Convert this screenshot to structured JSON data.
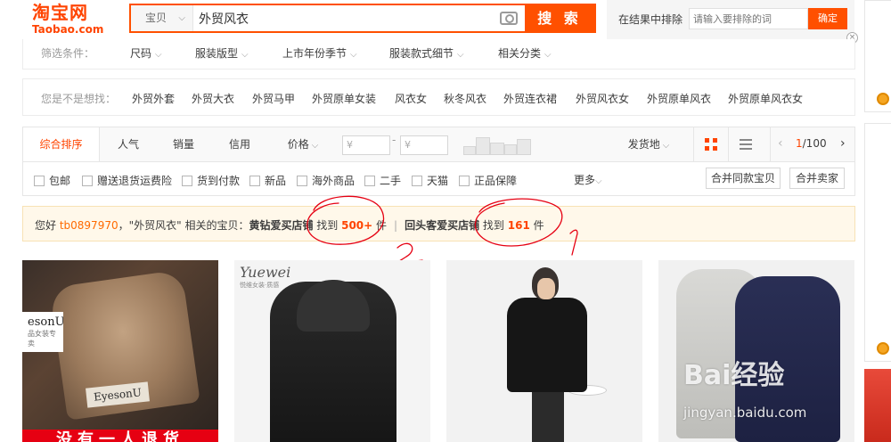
{
  "header": {
    "logo_cn": "淘宝网",
    "logo_en": "Taobao.com",
    "search_category": "宝贝",
    "search_query": "外贸风衣",
    "search_button": "搜 索",
    "exclude_label": "在结果中排除",
    "exclude_placeholder": "请输入要排除的词",
    "exclude_button": "确定"
  },
  "filters": {
    "title": "筛选条件：",
    "items": [
      "尺码",
      "服装版型",
      "上市年份季节",
      "服装款式细节",
      "相关分类"
    ]
  },
  "suggestions": {
    "title": "您是不是想找：",
    "items": [
      "外贸外套",
      "外贸大衣",
      "外贸马甲",
      "外贸原单女装",
      "风衣女",
      "秋冬风衣",
      "外贸连衣裙",
      "外贸风衣女",
      "外贸原单风衣",
      "外贸原单风衣女"
    ]
  },
  "sortbar": {
    "tabs": [
      "综合排序",
      "人气",
      "销量",
      "信用",
      "价格"
    ],
    "price_from_placeholder": "¥",
    "price_to_placeholder": "¥",
    "location": "发货地",
    "page_current": "1",
    "page_total": "/100"
  },
  "checkboxes": {
    "items": [
      "包邮",
      "赠送退货运费险",
      "货到付款",
      "新品",
      "海外商品",
      "二手",
      "天猫",
      "正品保障"
    ],
    "more": "更多",
    "merge_same": "合并同款宝贝",
    "merge_seller": "合并卖家"
  },
  "notice": {
    "greeting": "您好 ",
    "username": "tb0897970",
    "query_part": "，\"外贸风衣\" 相关的宝贝：",
    "group1_name": "黄钻爱买店铺",
    "group1_prefix": " 找到 ",
    "group1_count": "500+",
    "group1_suffix": " 件",
    "separator": "|",
    "group2_name": "回头客爱买店铺",
    "group2_prefix": " 找到 ",
    "group2_count": "161",
    "group2_suffix": " 件"
  },
  "products": {
    "p1_tag1": "esonU",
    "p1_tag1_sub": "品女装专卖",
    "p1_tag2": "EyesonU",
    "p1_banner": "没有一人退货",
    "p2_brand": "Yuewei",
    "p2_brand_sub": "悦维女装·质感"
  },
  "watermark": {
    "text": "Bai经验",
    "url": "jingyan.baidu.com"
  },
  "colors": {
    "brand": "#ff4400",
    "accent": "#ff5000",
    "notice_bg": "#fff8ea",
    "annotation": "#e60012"
  }
}
